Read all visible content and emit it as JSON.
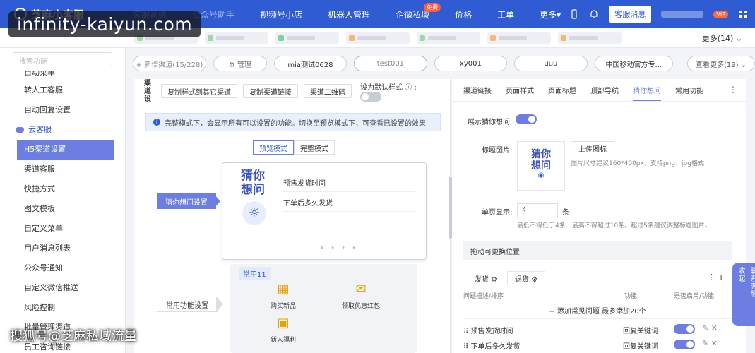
{
  "watermark": {
    "top": "infinity-kaiyun.com",
    "bottom": "搜狐号@芝麻私域流量"
  },
  "topnav": {
    "brand": "芝麻小客服",
    "items": [
      {
        "label": "客服系统",
        "dim": true
      },
      {
        "label": "公众号助手",
        "dim": true
      },
      {
        "label": "视频号小店"
      },
      {
        "label": "机器人管理"
      },
      {
        "label": "企微私域",
        "badge": "免费"
      },
      {
        "label": "价格"
      },
      {
        "label": "工单"
      },
      {
        "label": "更多▾"
      }
    ],
    "cs_button": "客服消息",
    "vip_badge": "VIP"
  },
  "tabstrip": {
    "more_label": "更多(14) ⌄"
  },
  "sidebar": {
    "search_placeholder": "搜索功能",
    "items_top": [
      "自动菜单"
    ],
    "items": [
      "转人工客服",
      "自动回复设置"
    ],
    "group": "云客服",
    "group_items": [
      "H5渠道设置",
      "渠道客服",
      "快捷方式",
      "图文模板",
      "自定义菜单",
      "用户消息列表",
      "公众号通知",
      "自定义微信推送",
      "风险控制",
      "批量管理渠道",
      "员工咨询链接"
    ]
  },
  "pills": {
    "add": "+ 新增渠道(15/228)",
    "manage": "⚙ 管理",
    "channels": [
      "mia测试0628",
      "test001",
      "xy001",
      "uuu",
      "中国移动官方专..."
    ],
    "more": "查看更多(19) ⌄"
  },
  "leftpanel": {
    "vertical_title": "渠道设",
    "buttons": [
      "复制样式到其它渠道",
      "复制渠道链接",
      "渠道二维码"
    ],
    "default_style_label": "设为默认样式 ⓘ :",
    "info_text": "完整模式下，会显示所有可以设置的功能。切换至预览模式下，可查看已设置的效果",
    "mode_preview": "预览模式",
    "mode_full": "完整模式",
    "guess": {
      "title": "猜你想问",
      "line1": "预售发货时间",
      "line2": "下单后多久发货",
      "dots": "• • • •"
    },
    "label_guess": "猜你想问设置",
    "label_common": "常用功能设置",
    "common": {
      "header": "常用11",
      "funcs": [
        "购买新品",
        "领取优惠红包",
        "新人福利"
      ]
    }
  },
  "rightpanel": {
    "tabs": [
      "渠道链接",
      "页面样式",
      "页面标题",
      "顶部导航",
      "猜你想问",
      "常用功能"
    ],
    "active_tab": "猜你想问",
    "more": "⋮",
    "show_guess_label": "展示猜你想问:",
    "title_image_label": "标题图片:",
    "upload_image_text": "猜你\n想问",
    "upload_button": "上传图标",
    "upload_hint": "图片尺寸建议160*400px，支持png、jpg格式",
    "per_page_label": "单页显示:",
    "per_page_value": "4",
    "per_page_unit": "条",
    "per_page_hint": "最低不得低于4条、最高不得超过10条。超过5条建议调整标题图片。",
    "drag_header": "拖动可更换位置",
    "sub_tabs": [
      "发货 ⚙",
      "退货 ⚙"
    ],
    "col_headers": [
      "问题描述/排序",
      "功能",
      "是否启用/功能"
    ],
    "add_line": "+ 添加常见问题 最多添加20个",
    "rows": [
      {
        "name": "⠿ 预售发货时间",
        "func": "回复关键词"
      },
      {
        "name": "⠿ 下单后多久发货",
        "func": "回复关键词"
      }
    ]
  },
  "contact_float": {
    "collapse": "收起",
    "contact": "联系客服"
  }
}
